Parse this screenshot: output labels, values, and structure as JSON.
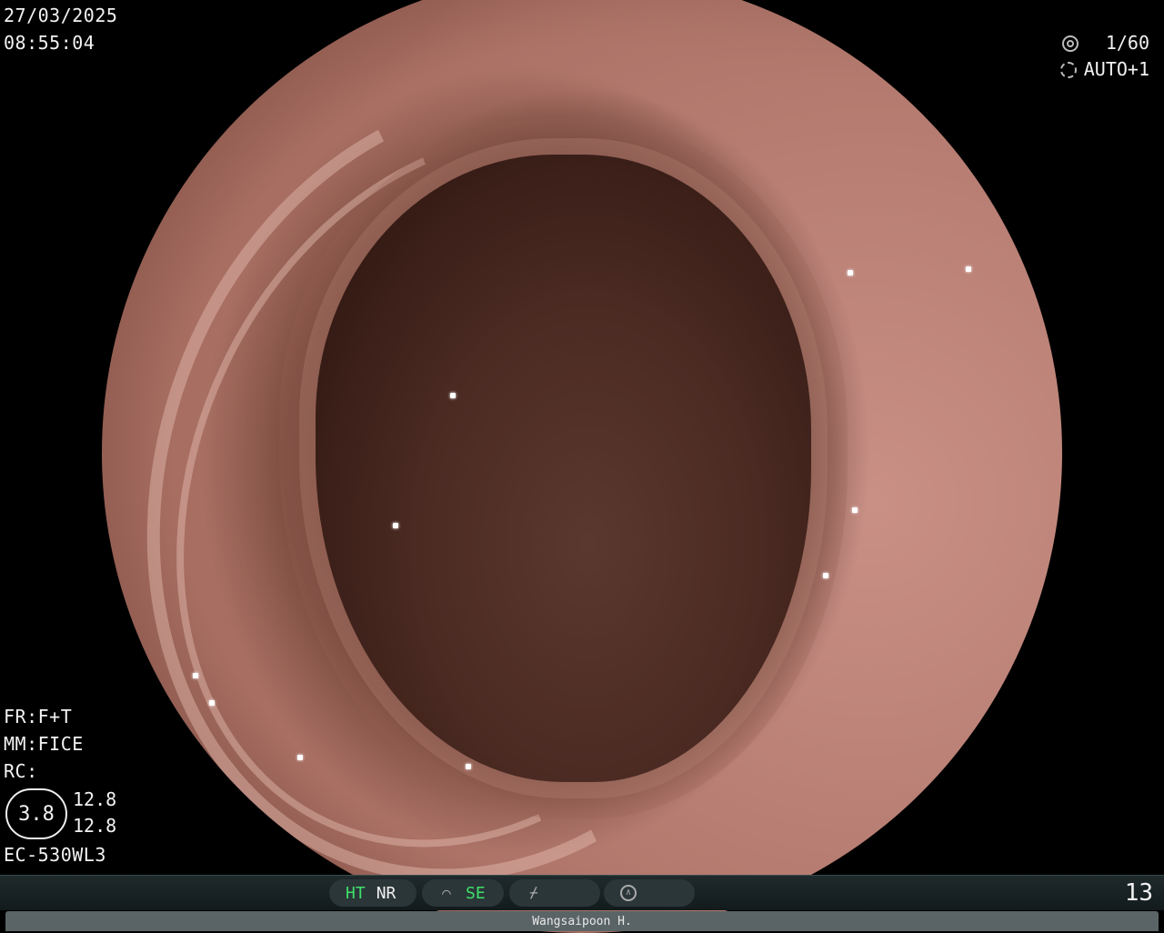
{
  "header": {
    "date": "27/03/2025",
    "time": "08:55:04"
  },
  "camera": {
    "shutter": "1/60",
    "iris": "AUTO+1",
    "shutter_icon": "shutter-icon",
    "iris_icon": "iris-icon"
  },
  "settings": {
    "fr": "FR:F+T",
    "mm": "MM:FICE",
    "rc": "RC:"
  },
  "enhancement": {
    "level": "3.8",
    "value_top": "12.8",
    "value_bottom": "12.8"
  },
  "scope_model": "EC-530WL3",
  "statusbar": {
    "ht": "HT",
    "nr": "NR",
    "se": "SE",
    "colors": {
      "active": "#3ee06a",
      "inactive": "#f0f0f0"
    }
  },
  "image_counter": "13",
  "physician": "Wangsaipoon H."
}
